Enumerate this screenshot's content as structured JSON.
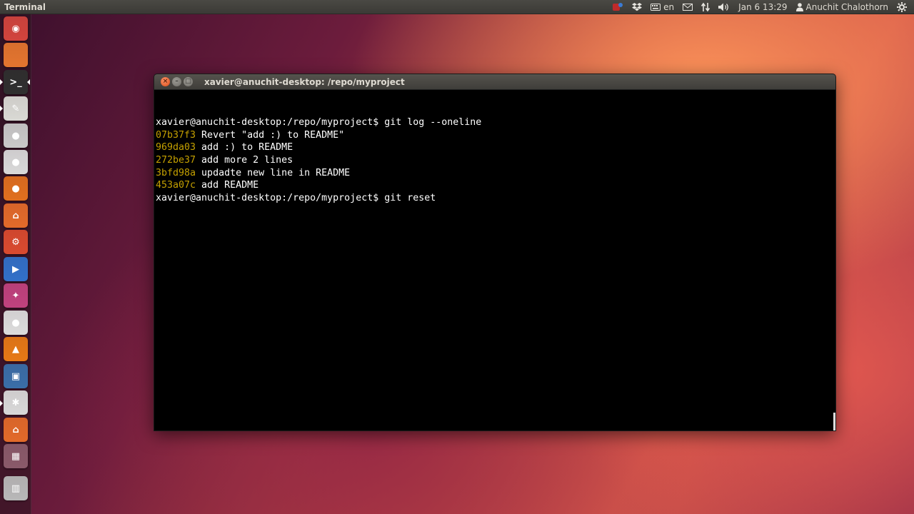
{
  "top_panel": {
    "app_name": "Terminal",
    "keyboard_layout": "en",
    "clock": "Jan 6 13:29",
    "user_name": "Anuchit Chalothorn"
  },
  "launcher": {
    "items": [
      {
        "name": "dash",
        "glyph": "◉",
        "color": "#d1443d"
      },
      {
        "name": "files",
        "glyph": "",
        "color": "#e3752f"
      },
      {
        "name": "terminal",
        "glyph": ">_",
        "color": "#2f2f2f"
      },
      {
        "name": "text-editor",
        "glyph": "✎",
        "color": "#d9d9d4"
      },
      {
        "name": "disc",
        "glyph": "●",
        "color": "#c9c9c9"
      },
      {
        "name": "chrome",
        "glyph": "●",
        "color": "#d9d9d9"
      },
      {
        "name": "firefox",
        "glyph": "●",
        "color": "#e06f1f"
      },
      {
        "name": "software-center",
        "glyph": "⌂",
        "color": "#e26a2a"
      },
      {
        "name": "system-settings",
        "glyph": "⚙",
        "color": "#d94a2f"
      },
      {
        "name": "media-player",
        "glyph": "▶",
        "color": "#3270c8"
      },
      {
        "name": "remote-app",
        "glyph": "✦",
        "color": "#c0427e"
      },
      {
        "name": "dvd",
        "glyph": "●",
        "color": "#dcdcdc"
      },
      {
        "name": "vlc",
        "glyph": "▲",
        "color": "#e67916"
      },
      {
        "name": "virtualbox",
        "glyph": "▣",
        "color": "#3a6ea8"
      },
      {
        "name": "network-tool",
        "glyph": "✱",
        "color": "#d8d8d8"
      },
      {
        "name": "home-folder",
        "glyph": "⌂",
        "color": "#e26a2a"
      },
      {
        "name": "workspaces",
        "glyph": "▦",
        "color": "#8a5a6a"
      },
      {
        "name": "trash",
        "glyph": "▥",
        "color": "#b8b8b8"
      }
    ]
  },
  "terminal": {
    "title": "xavier@anuchit-desktop: /repo/myproject",
    "lines": [
      {
        "hash": "",
        "text": "xavier@anuchit-desktop:/repo/myproject$ git log --oneline"
      },
      {
        "hash": "07b37f3",
        "text": " Revert \"add :) to README\""
      },
      {
        "hash": "969da03",
        "text": " add :) to README"
      },
      {
        "hash": "272be37",
        "text": " add more 2 lines"
      },
      {
        "hash": "3bfd98a",
        "text": " updadte new line in README"
      },
      {
        "hash": "453a07c",
        "text": " add README"
      },
      {
        "hash": "",
        "text": "xavier@anuchit-desktop:/repo/myproject$ git reset"
      }
    ]
  }
}
